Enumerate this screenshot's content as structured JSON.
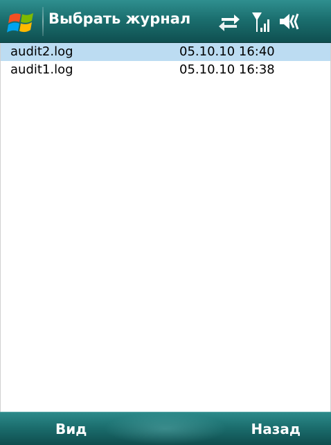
{
  "titlebar": {
    "title": "Выбрать журнал",
    "start_icon": "windows-flag-icon",
    "status_icons": [
      "sync-arrows-icon",
      "signal-strength-icon",
      "volume-icon"
    ]
  },
  "logs": [
    {
      "name": "audit2.log",
      "date": "05.10.10 16:40",
      "selected": true
    },
    {
      "name": "audit1.log",
      "date": "05.10.10 16:38",
      "selected": false
    }
  ],
  "softkeys": {
    "left_label": "Вид",
    "right_label": "Назад"
  },
  "colors": {
    "title_bar": "#1b6f6f",
    "selection": "#bcdcf2",
    "text": "#000000"
  }
}
